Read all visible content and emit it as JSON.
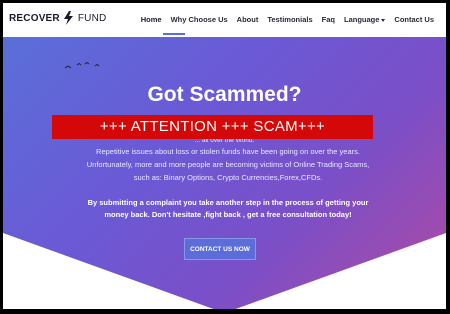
{
  "brand": {
    "name_bold": "RECOVER",
    "name_light": "FUND"
  },
  "nav": {
    "items": [
      {
        "label": "Home"
      },
      {
        "label": "Why Choose Us"
      },
      {
        "label": "About"
      },
      {
        "label": "Testimonials"
      },
      {
        "label": "Faq"
      },
      {
        "label": "Language"
      },
      {
        "label": "Contact Us"
      }
    ],
    "active_index": 0
  },
  "hero": {
    "title": "Got Scammed?",
    "partial_text": "... all over the World.",
    "description": "Repetitive issues about loss or stolen funds have been going on over the years. Unfortunately, more and more people are becoming victims of Online Trading Scams, such as: Binary Options, Crypto Currencies,Forex,CFDs.",
    "cta_text": "By submitting a complaint you take another step in the process of getting your money back. Don't hesitate ,fight back , get a free consultation today!",
    "button_label": "CONTACT US NOW"
  },
  "warning_banner": {
    "text": "+++ ATTENTION +++ SCAM+++"
  },
  "colors": {
    "hero_gradient_start": "#5a6fd8",
    "hero_gradient_end": "#b24aa0",
    "banner": "#d40808",
    "button": "#5c6cd9"
  }
}
